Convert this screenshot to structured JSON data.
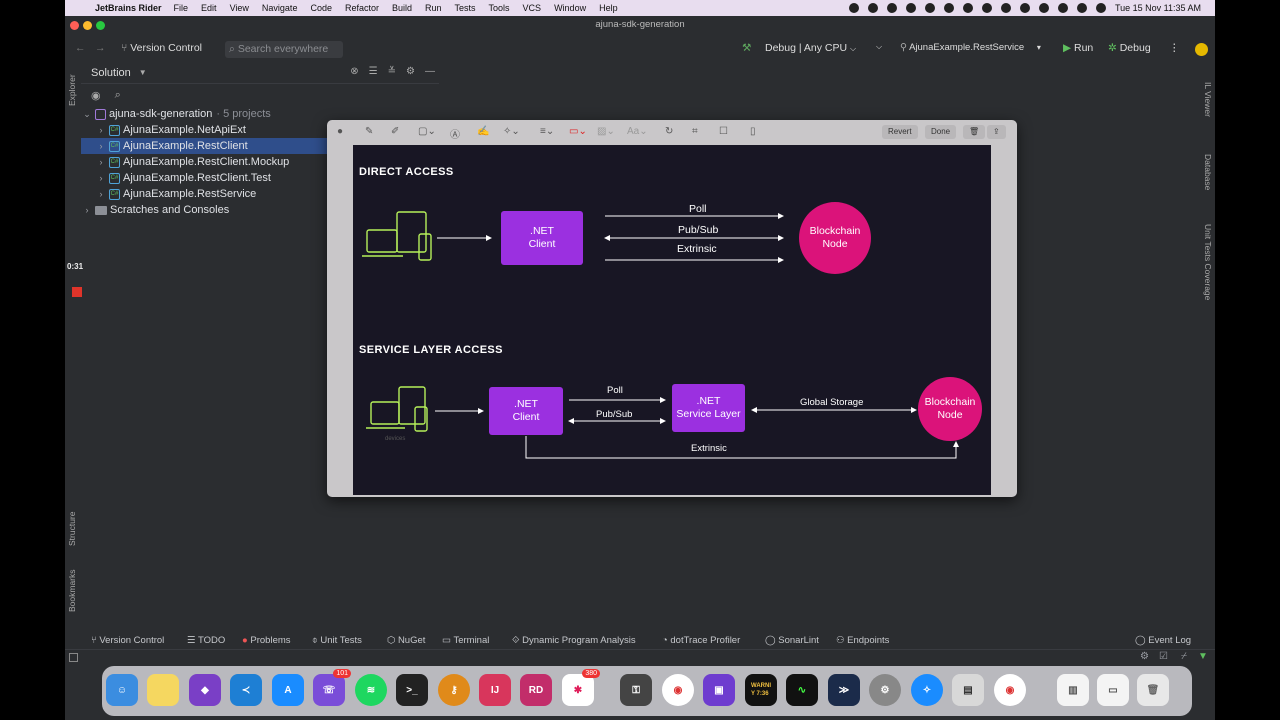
{
  "menubar": {
    "app_name": "JetBrains Rider",
    "items": [
      "File",
      "Edit",
      "View",
      "Navigate",
      "Code",
      "Refactor",
      "Build",
      "Run",
      "Tests",
      "Tools",
      "VCS",
      "Window",
      "Help"
    ],
    "clock": "Tue 15 Nov  11:35 AM"
  },
  "window": {
    "title": "ajuna-sdk-generation"
  },
  "toolbar": {
    "version_control": "Version Control",
    "search_placeholder": "Search everywhere",
    "config": "Debug | Any CPU",
    "run_target": "AjunaExample.RestService",
    "run_label": "Run",
    "debug_label": "Debug"
  },
  "left_strip": {
    "explorer": "Explorer",
    "structure": "Structure",
    "bookmarks": "Bookmarks"
  },
  "recording": {
    "time": "0:31"
  },
  "right_strip": {
    "il_viewer": "IL Viewer",
    "database": "Database",
    "unit_tests_coverage": "Unit Tests Coverage"
  },
  "solution": {
    "title": "Solution",
    "root": {
      "label": "ajuna-sdk-generation",
      "meta": "· 5 projects"
    },
    "projects": [
      {
        "label": "AjunaExample.NetApiExt",
        "selected": false
      },
      {
        "label": "AjunaExample.RestClient",
        "selected": true
      },
      {
        "label": "AjunaExample.RestClient.Mockup",
        "selected": false
      },
      {
        "label": "AjunaExample.RestClient.Test",
        "selected": false
      },
      {
        "label": "AjunaExample.RestService",
        "selected": false
      }
    ],
    "scratches": "Scratches and Consoles"
  },
  "preview": {
    "revert_label": "Revert",
    "done_label": "Done"
  },
  "diagram": {
    "direct": {
      "title": "DIRECT ACCESS",
      "client": ".NET\nClient",
      "node": "Blockchain\nNode",
      "edges": [
        "Poll",
        "Pub/Sub",
        "Extrinsic"
      ]
    },
    "service": {
      "title": "SERVICE LAYER ACCESS",
      "devices_label": "devices",
      "client": ".NET\nClient",
      "service_layer": ".NET\nService Layer",
      "node": "Blockchain\nNode",
      "edges": [
        "Poll",
        "Pub/Sub",
        "Global Storage",
        "Extrinsic"
      ]
    }
  },
  "bottombar": {
    "items": [
      "Version Control",
      "TODO",
      "Problems",
      "Unit Tests",
      "NuGet",
      "Terminal",
      "Dynamic Program Analysis",
      "dotTrace Profiler",
      "SonarLint",
      "Endpoints"
    ],
    "event_log": "Event Log"
  },
  "dock": {
    "viber_badge": "101",
    "slack_badge": "380",
    "ij_label": "IJ",
    "rd_label": "RD",
    "console_text": "WARNI\nY 7:36"
  },
  "colors": {
    "ide_bg": "#2b2d30",
    "selection": "#2f4e8b",
    "diagram_bg": "#181624",
    "purple_box": "#9b30e0",
    "magenta_node": "#db137a",
    "device_green": "#b6f05a"
  }
}
